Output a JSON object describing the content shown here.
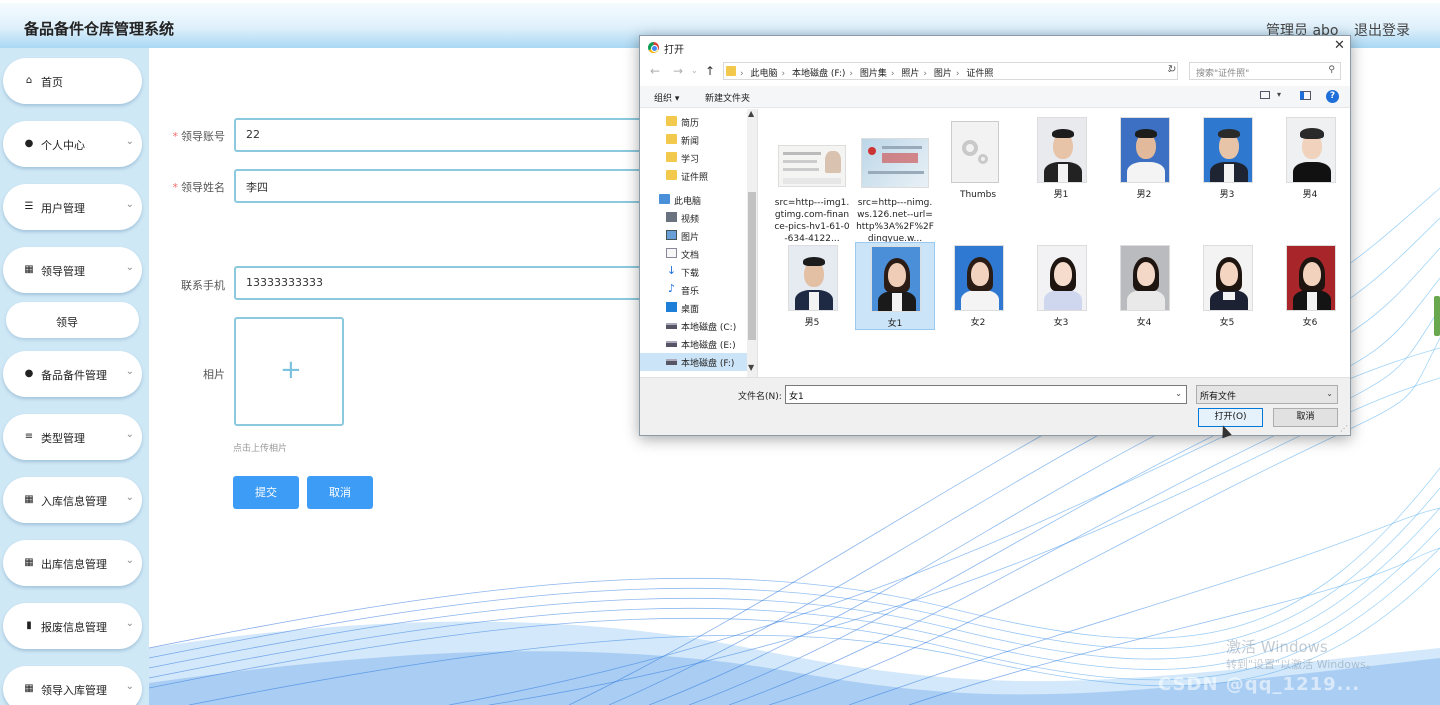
{
  "header": {
    "title": "备品备件仓库管理系统",
    "user": "管理员 abo",
    "logout": "退出登录"
  },
  "sidebar": {
    "items": [
      {
        "label": "首页",
        "icon": "home-icon"
      },
      {
        "label": "个人中心",
        "icon": "user-icon"
      },
      {
        "label": "用户管理",
        "icon": "list-icon"
      },
      {
        "label": "领导管理",
        "icon": "grid-icon"
      },
      {
        "label": "领导",
        "icon": ""
      },
      {
        "label": "备品备件管理",
        "icon": "user-icon"
      },
      {
        "label": "类型管理",
        "icon": "sliders-icon"
      },
      {
        "label": "入库信息管理",
        "icon": "grid-icon"
      },
      {
        "label": "出库信息管理",
        "icon": "grid-icon"
      },
      {
        "label": "报废信息管理",
        "icon": "chart-icon"
      },
      {
        "label": "领导入库管理",
        "icon": "grid-icon"
      }
    ]
  },
  "form": {
    "account_label": "领导账号",
    "account_value": "22",
    "name_label": "领导姓名",
    "name_value": "李四",
    "phone_label": "联系手机",
    "phone_value": "13333333333",
    "photo_label": "相片",
    "upload_tip": "点击上传相片",
    "submit": "提交",
    "cancel": "取消"
  },
  "dialog": {
    "title": "打开",
    "path": [
      "此电脑",
      "本地磁盘 (F:)",
      "图片集",
      "照片",
      "图片",
      "证件照"
    ],
    "search_placeholder": "搜索\"证件照\"",
    "organize": "组织 ▾",
    "new_folder": "新建文件夹",
    "tree": [
      "简历",
      "新闻",
      "学习",
      "证件照",
      "此电脑",
      "视频",
      "图片",
      "文档",
      "下载",
      "音乐",
      "桌面",
      "本地磁盘 (C:)",
      "本地磁盘 (E:)",
      "本地磁盘 (F:)"
    ],
    "files": [
      {
        "name": "src=http---img1.gtimg.com-finance-pics-hv1-61-0-634-4122..."
      },
      {
        "name": "src=http---nimg.ws.126.net--url=http%3A%2F%2Fdingyue.w..."
      },
      {
        "name": "Thumbs"
      },
      {
        "name": "男1"
      },
      {
        "name": "男2"
      },
      {
        "name": "男3"
      },
      {
        "name": "男4"
      },
      {
        "name": "男5"
      },
      {
        "name": "女1"
      },
      {
        "name": "女2"
      },
      {
        "name": "女3"
      },
      {
        "name": "女4"
      },
      {
        "name": "女5"
      },
      {
        "name": "女6"
      }
    ],
    "filename_label": "文件名(N):",
    "filename_value": "女1",
    "filetype_value": "所有文件",
    "open_button": "打开(O)",
    "cancel_button": "取消"
  },
  "watermark": {
    "line1": "激活 Windows",
    "line2": "转到\"设置\"以激活 Windows。",
    "line3": "CSDN @qq_1219..."
  },
  "colors": {
    "accent": "#3d9cf5",
    "input_border": "#8cc9de",
    "sidebar_bg": "#cfe8f6"
  }
}
